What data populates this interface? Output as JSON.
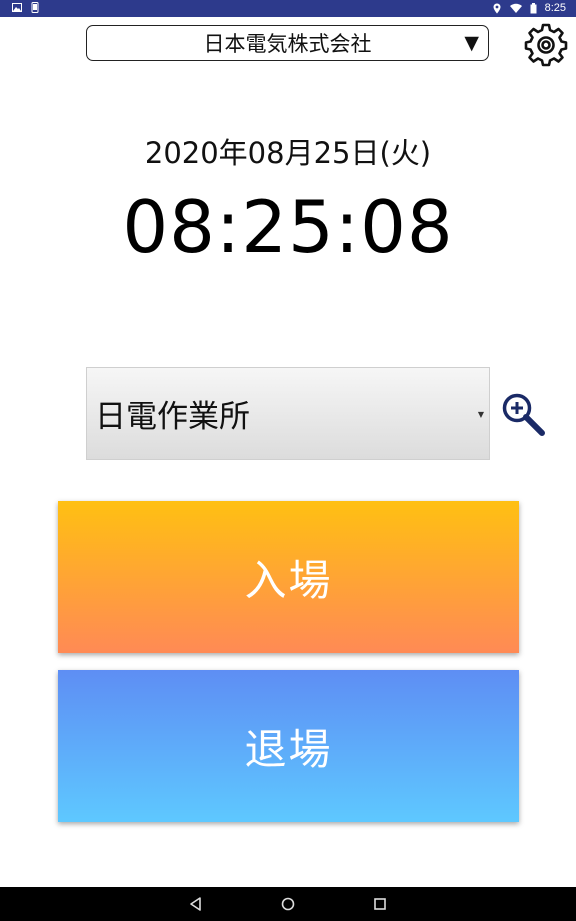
{
  "status_bar": {
    "time": "8:25",
    "left_icons": [
      "image-icon",
      "phone-icon"
    ],
    "right_icons": [
      "location-icon",
      "wifi-icon",
      "battery-icon"
    ],
    "color": "#2d3a8c"
  },
  "header": {
    "company": "日本電気株式会社",
    "dropdown_arrow": "▼",
    "settings_icon": "gear-icon"
  },
  "clock": {
    "date": "2020年08月25日(火)",
    "time": "08:25:08"
  },
  "site_select": {
    "value": "日電作業所",
    "search_icon": "zoom-in-icon"
  },
  "buttons": {
    "enter": "入場",
    "exit": "退場",
    "enter_colors": [
      "#ffc012",
      "#ff8a55"
    ],
    "exit_colors": [
      "#5e8ef4",
      "#5ec8ff"
    ]
  },
  "nav_bar": {
    "icons": [
      "back-icon",
      "home-icon",
      "recents-icon"
    ]
  }
}
